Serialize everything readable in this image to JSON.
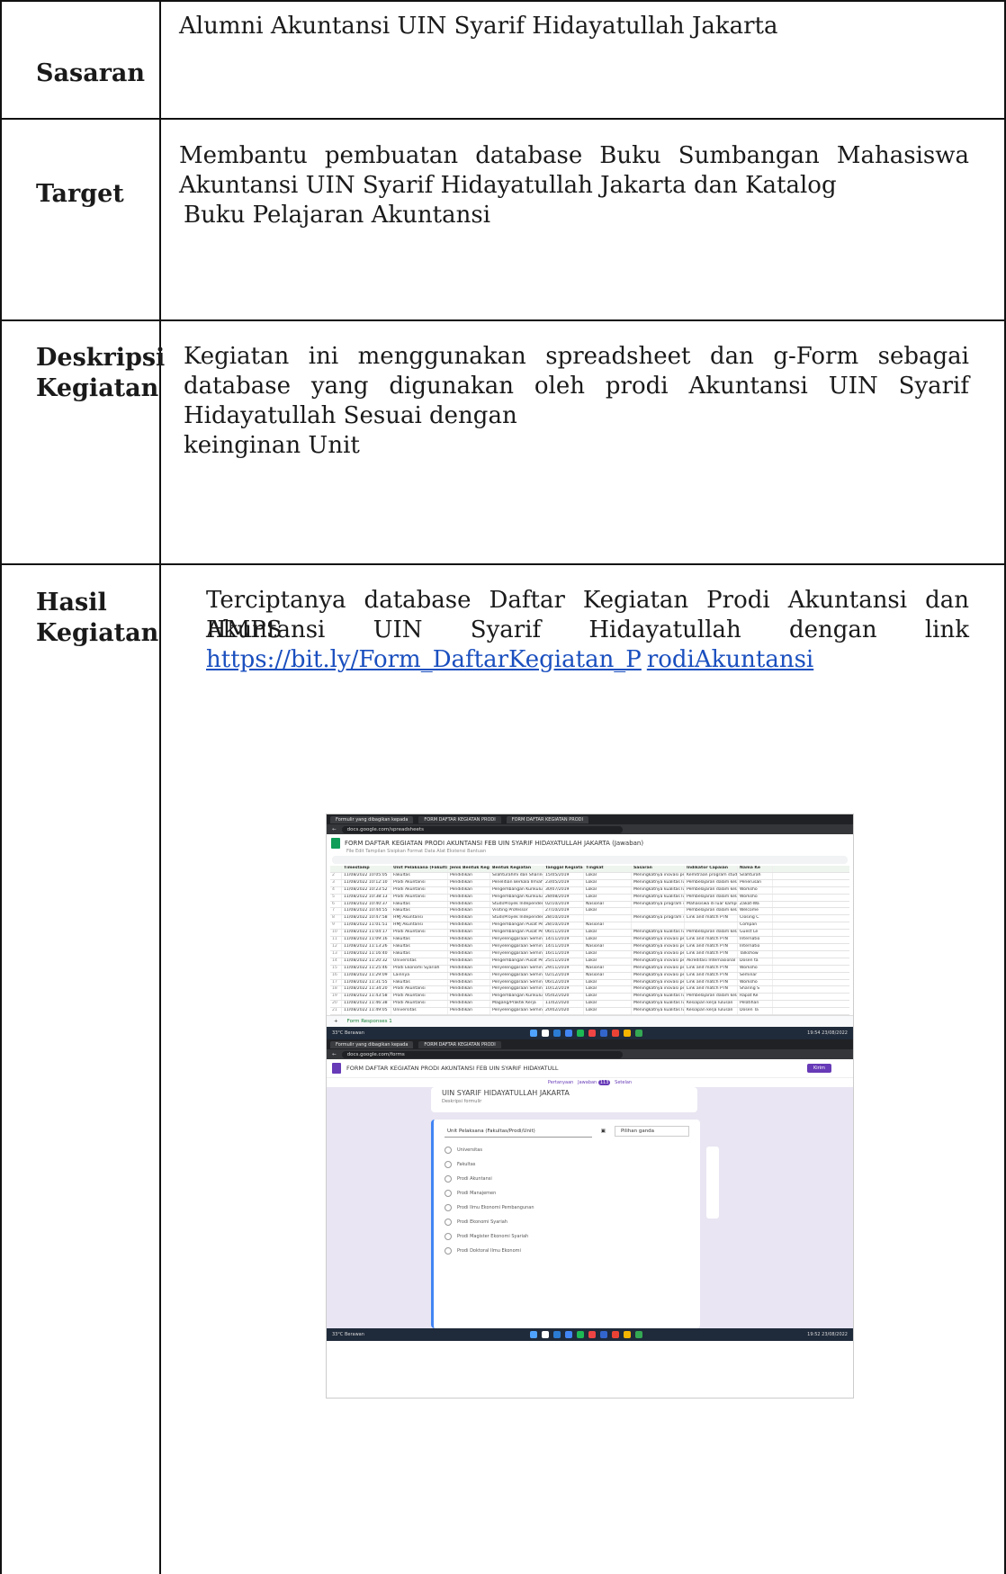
{
  "rows": {
    "sasaran": {
      "label": "Sasaran",
      "content": "Alumni Akuntansi UIN Syarif Hidayatullah Jakarta"
    },
    "target": {
      "label": "Target",
      "line1": "Membantu pembuatan database Buku Sumbangan Mahasiswa",
      "line2": "Akuntansi UIN Syarif Hidayatullah Jakarta dan Katalog",
      "line3": "Buku Pelajaran Akuntansi"
    },
    "deskripsi": {
      "label_line1": "Deskripsi",
      "label_line2": "Kegiatan",
      "line1": "Kegiatan ini menggunakan spreadsheet dan g-Form sebagai",
      "line2": "database yang digunakan oleh prodi Akuntansi UIN Syarif",
      "line3": "Hidayatullah Sesuai dengan",
      "line4": "keinginan Unit"
    },
    "hasil": {
      "label_line1": "Hasil",
      "label_line2": "Kegiatan",
      "line1": "Terciptanya database Daftar Kegiatan Prodi Akuntansi dan HMPS",
      "line2": "Akuntansi UIN Syarif Hidayatullah dengan link",
      "link_part1": "https://bit.ly/Form_DaftarKegiatan_P",
      "link_part2": "rodiAkuntansi"
    }
  },
  "screenshot": {
    "tab1": "Formulir yang dibagikan kepada",
    "tab2": "FORM DAFTAR KEGIATAN PRODI",
    "tab3": "FORM DAFTAR KEGIATAN PRODI",
    "sheet_url": "docs.google.com/spreadsheets",
    "sheet_title": "FORM DAFTAR KEGIATAN PRODI AKUNTANSI FEB UIN SYARIF HIDAYATULLAH JAKARTA (Jawaban)",
    "sheet_menu": "File  Edit  Tampilan  Sisipkan  Format  Data  Alat  Ekstensi  Bantuan",
    "headers": [
      "",
      "Timestamp",
      "Unit Pelaksana (Fakultas",
      "Jenis Bentuk Kegiatan",
      "Bentuk Kegiatan",
      "Tanggal Kegiatan",
      "Tingkat",
      "Sasaran",
      "Indikator Capaian",
      "Nama Ke"
    ],
    "grid_rows": [
      [
        "2",
        "11/08/2022 10:05:05",
        "Fakultas",
        "Pendidikan",
        "Silahturahmi dan Sharing",
        "15/05/2019",
        "Lokal",
        "Meningkatnya inovasi pe",
        "Kemitraan program studi",
        "Silahturah"
      ],
      [
        "3",
        "11/08/2022 10:12:10",
        "Prodi Akuntansi",
        "Pendidikan",
        "Penelitian Berkala Ilmiah",
        "23/05/2019",
        "Lokal",
        "Meningkatnya kualitas lu",
        "Pembelajaran dalam kela",
        "Penerusan"
      ],
      [
        "4",
        "11/08/2022 10:23:52",
        "Prodi Akuntansi",
        "Pendidikan",
        "Pengembangan Kurikulu",
        "30/07/2019",
        "Lokal",
        "Meningkatnya kualitas lu",
        "Pembelajaran dalam kela",
        "Worksho"
      ],
      [
        "5",
        "11/08/2022 10:38:13",
        "Prodi Akuntansi",
        "Pendidikan",
        "Pengembangan Kurikulu",
        "28/08/2019",
        "Lokal",
        "Meningkatnya kualitas lu",
        "Pembelajaran dalam kela",
        "Worksho"
      ],
      [
        "6",
        "11/08/2022 10:40:37",
        "Fakultas",
        "Pendidikan",
        "Studi/Proyek Independen",
        "02/10/2019",
        "Nasional",
        "Meningkatnya program s",
        "Mahasiswa di luar kampu",
        "Zakat-Wa"
      ],
      [
        "7",
        "11/08/2022 10:44:55",
        "Fakultas",
        "Pendidikan",
        "Visiting Professor",
        "27/10/2019",
        "Lokal",
        "",
        "Pembelajaran dalam kela",
        "Welcome"
      ],
      [
        "8",
        "11/08/2022 10:47:58",
        "HMJ Akuntansi",
        "Pendidikan",
        "Studi/Proyek Independen",
        "28/10/2019",
        "",
        "Meningkatnya program s",
        "Link and match PTN",
        "Closing C"
      ],
      [
        "9",
        "11/08/2022 11:01:51",
        "HMJ Akuntansi",
        "Pendidikan",
        "Pengembangan Pusat Pe",
        "28/10/2019",
        "Nasional",
        "",
        "",
        "Compan"
      ],
      [
        "10",
        "11/08/2022 11:04:17",
        "Prodi Akuntansi",
        "Pendidikan",
        "Pengembangan Pusat Pe",
        "06/11/2019",
        "Lokal",
        "Meningkatnya kualitas lu",
        "Pembelajaran dalam kela",
        "Guest Le"
      ],
      [
        "11",
        "11/08/2022 11:09:16",
        "Fakultas",
        "Pendidikan",
        "Penyelenggaraan Semin",
        "14/11/2019",
        "Lokal",
        "Meningkatnya inovasi pe",
        "Link and match PTN",
        "Internatio"
      ],
      [
        "12",
        "11/08/2022 11:13:26",
        "Fakultas",
        "Pendidikan",
        "Penyelenggaraan Semin",
        "14/11/2019",
        "Nasional",
        "Meningkatnya inovasi pe",
        "Link and match PTN",
        "Internatio"
      ],
      [
        "13",
        "11/08/2022 11:16:40",
        "Fakultas",
        "Pendidikan",
        "Penyelenggaraan Semin",
        "16/11/2019",
        "Lokal",
        "Meningkatnya inovasi pe",
        "Link and match PTN",
        "Talkshow"
      ],
      [
        "14",
        "11/08/2022 11:20:32",
        "Universitas",
        "Pendidikan",
        "Pengembangan Pusat Pe",
        "25/11/2019",
        "Lokal",
        "Meningkatnya inovasi pe",
        "Akreditasi Internasional",
        "Dosen ta"
      ],
      [
        "15",
        "11/08/2022 11:25:46",
        "Prodi Ekonomi Syariah",
        "Pendidikan",
        "Penyelenggaraan Semin",
        "29/11/2019",
        "Nasional",
        "Meningkatnya inovasi pe",
        "Link and match PTN",
        "Worksho"
      ],
      [
        "16",
        "11/08/2022 11:29:09",
        "Lainnya",
        "Pendidikan",
        "Penyelenggaraan Semin",
        "02/12/2019",
        "Nasional",
        "Meningkatnya inovasi pe",
        "Link and match PTN",
        "Seminar"
      ],
      [
        "17",
        "11/08/2022 11:31:55",
        "Fakultas",
        "Pendidikan",
        "Penyelenggaraan Semin",
        "06/12/2019",
        "Lokal",
        "Meningkatnya inovasi pe",
        "Link and match PTN",
        "Worksho"
      ],
      [
        "18",
        "11/08/2022 11:34:20",
        "Prodi Akuntansi",
        "Pendidikan",
        "Penyelenggaraan Semin",
        "10/12/2019",
        "Lokal",
        "Meningkatnya inovasi pe",
        "Link and match PTN",
        "Sharing S"
      ],
      [
        "19",
        "11/08/2022 11:43:58",
        "Prodi Akuntansi",
        "Pendidikan",
        "Pengembangan Kurikulu",
        "05/02/2020",
        "Lokal",
        "Meningkatnya kualitas lu",
        "Pembelajaran dalam kela",
        "Rapat Ke"
      ],
      [
        "20",
        "11/08/2022 11:46:38",
        "Prodi Akuntansi",
        "Pendidikan",
        "Magang/Praktik Kerja",
        "11/02/2020",
        "Lokal",
        "Meningkatnya kualitas lu",
        "Kesiapan kerja lulusan",
        "Pelatihan"
      ],
      [
        "21",
        "11/08/2022 11:49:05",
        "Universitas",
        "Pendidikan",
        "Penyelenggaraan Semin",
        "20/02/2020",
        "Lokal",
        "Meningkatnya kualitas lu",
        "Kesiapan kerja lulusan",
        "Dosen Ta"
      ]
    ],
    "sheet_tab": "Form Responses 1",
    "weather1": "33°C",
    "weather1_sub": "Berawan",
    "clock1": "19:54",
    "date1": "23/08/2022",
    "forms_url": "docs.google.com/forms",
    "forms_title": "FORM DAFTAR KEGIATAN PRODI AKUNTANSI FEB UIN SYARIF HIDAYATULL",
    "send": "Kirim",
    "forms_tab_q": "Pertanyaan",
    "forms_tab_a": "Jawaban",
    "forms_tab_count": "113",
    "forms_tab_s": "Setelan",
    "forms_heading": "UIN SYARIF HIDAYATULLAH JAKARTA",
    "forms_desc": "Deskripsi formulir",
    "question": "Unit Pelaksana (Fakultas/Prodi/Unit)",
    "qtype": "Pilihan ganda",
    "options": [
      "Universitas",
      "Fakultas",
      "Prodi Akuntansi",
      "Prodi Manajemen",
      "Prodi Ilmu Ekonomi Pembangunan",
      "Prodi Ekonomi Syariah",
      "Prodi Magister Ekonomi Syariah",
      "Prodi Doktoral Ilmu Ekonomi"
    ],
    "weather2": "33°C",
    "weather2_sub": "Berawan",
    "clock2": "19:52",
    "date2": "23/08/2022"
  }
}
